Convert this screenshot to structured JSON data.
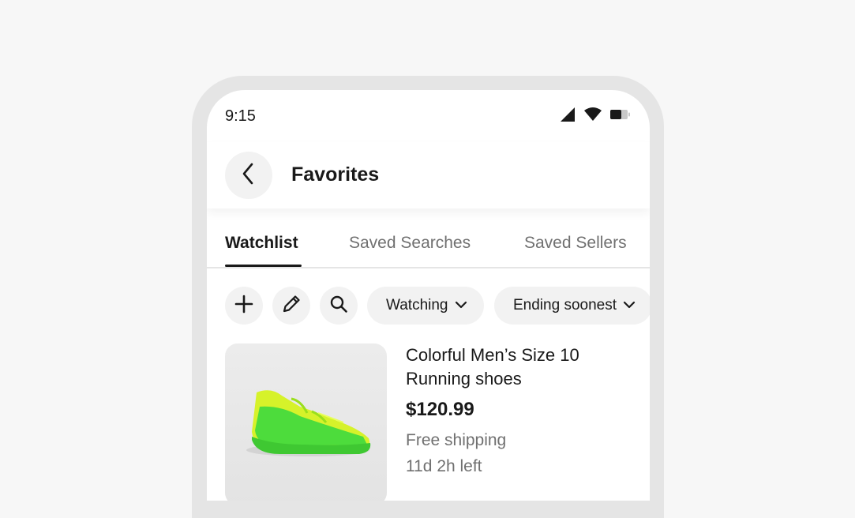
{
  "status_bar": {
    "time": "9:15",
    "icons": [
      "signal-icon",
      "wifi-icon",
      "battery-icon"
    ]
  },
  "header": {
    "back_icon": "chevron-left-icon",
    "title": "Favorites"
  },
  "tabs": [
    {
      "label": "Watchlist",
      "active": true
    },
    {
      "label": "Saved Searches",
      "active": false
    },
    {
      "label": "Saved Sellers",
      "active": false
    }
  ],
  "toolbar": {
    "icons": [
      "plus-icon",
      "pencil-icon",
      "search-icon"
    ],
    "filters": [
      {
        "label": "Watching",
        "icon": "chevron-down-icon"
      },
      {
        "label": "Ending soonest",
        "icon": "chevron-down-icon"
      }
    ]
  },
  "items": [
    {
      "title": "Colorful Men’s Size 10 Running shoes",
      "price": "$120.99",
      "shipping": "Free shipping",
      "time_left": "11d 2h left"
    }
  ],
  "colors": {
    "background": "#f7f7f7",
    "frame": "#e5e5e5",
    "text_primary": "#191919",
    "text_secondary": "#707070",
    "chip_bg": "#f2f2f2",
    "shoe_green": "#4ddc3c",
    "shoe_yellow": "#d6f22a"
  }
}
